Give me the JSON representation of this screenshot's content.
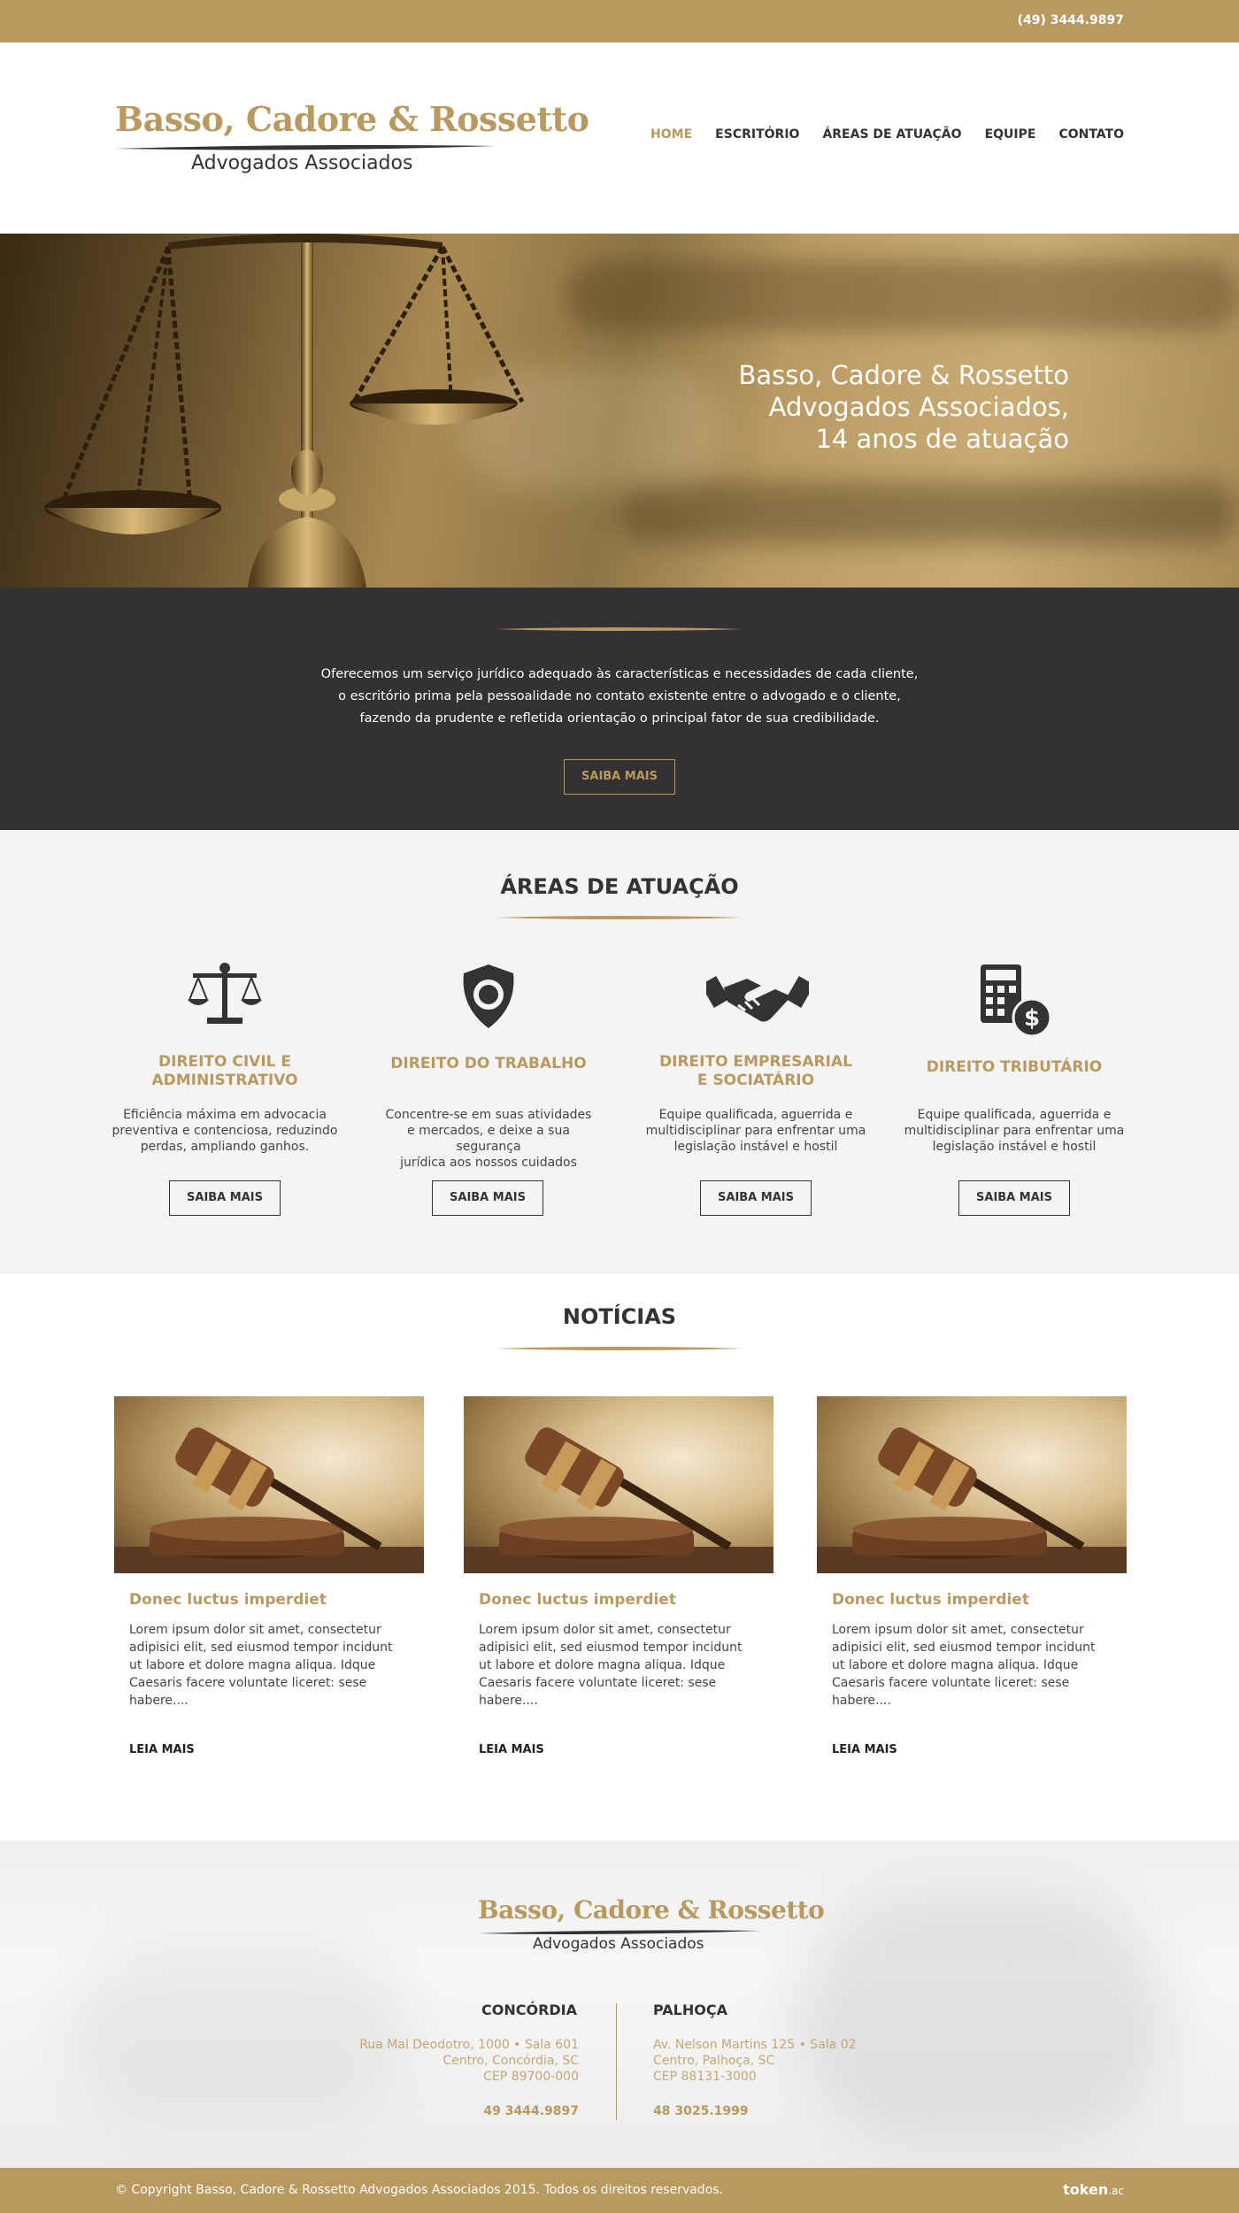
{
  "topbar": {
    "phone": "(49) 3444.9897"
  },
  "header": {
    "logo_line1": "Basso, Cadore & Rossetto",
    "logo_line2": "Advogados Associados",
    "nav": [
      "HOME",
      "ESCRITÓRIO",
      "ÁREAS DE ATUAÇÃO",
      "EQUIPE",
      "CONTATO"
    ]
  },
  "hero": {
    "line1": "Basso, Cadore & Rossetto",
    "line2": "Advogados Associados,",
    "line3": "14 anos de atuação"
  },
  "intro": {
    "line1": "Oferecemos um serviço jurídico adequado às características e necessidades de cada cliente,",
    "line2": "o escritório prima pela pessoalidade no contato existente entre o advogado e o cliente,",
    "line3": "fazendo da prudente e refletida orientação o principal fator de sua credibilidade.",
    "button": "SAIBA MAIS"
  },
  "areas": {
    "title": "ÁREAS DE ATUAÇÃO",
    "items": [
      {
        "title1": "DIREITO CIVIL E",
        "title2": "ADMINISTRATIVO",
        "text1": "Eficiência máxima em advocacia",
        "text2": "preventiva e contenciosa, reduzindo",
        "text3": "perdas, ampliando ganhos.",
        "button": "SAIBA MAIS",
        "icon": "scales-icon"
      },
      {
        "title1": "DIREITO DO TRABALHO",
        "title2": "",
        "text1": "Concentre-se em suas atividades",
        "text2": "e mercados, e deixe a sua segurança",
        "text3": "jurídica aos nossos cuidados",
        "button": "SAIBA MAIS",
        "icon": "badge-icon"
      },
      {
        "title1": "DIREITO EMPRESARIAL",
        "title2": "E SOCIATÁRIO",
        "text1": "Equipe qualificada, aguerrida e",
        "text2": "multidisciplinar para enfrentar uma",
        "text3": "legislação instável e hostil",
        "button": "SAIBA MAIS",
        "icon": "handshake-icon"
      },
      {
        "title1": "DIREITO TRIBUTÁRIO",
        "title2": "",
        "text1": "Equipe qualificada, aguerrida e",
        "text2": "multidisciplinar para enfrentar uma",
        "text3": "legislação instável e hostil",
        "button": "SAIBA MAIS",
        "icon": "calculator-dollar-icon"
      }
    ]
  },
  "news": {
    "title": "NOTÍCIAS",
    "items": [
      {
        "title": "Donec luctus imperdiet",
        "text": "Lorem ipsum dolor sit amet, consectetur adipisici elit, sed eiusmod tempor incidunt ut labore et dolore magna aliqua. Idque Caesaris facere voluntate liceret: sese habere....",
        "more": "LEIA MAIS"
      },
      {
        "title": "Donec luctus imperdiet",
        "text": "Lorem ipsum dolor sit amet, consectetur adipisici elit, sed eiusmod tempor incidunt ut labore et dolore magna aliqua. Idque Caesaris facere voluntate liceret: sese habere....",
        "more": "LEIA MAIS"
      },
      {
        "title": "Donec luctus imperdiet",
        "text": "Lorem ipsum dolor sit amet, consectetur adipisici elit, sed eiusmod tempor incidunt ut labore et dolore magna aliqua. Idque Caesaris facere voluntate liceret: sese habere....",
        "more": "LEIA MAIS"
      }
    ]
  },
  "footer": {
    "logo_line1": "Basso, Cadore & Rossetto",
    "logo_line2": "Advogados Associados",
    "offices": [
      {
        "name": "CONCÓRDIA",
        "addr1": "Rua Mal Deodotro, 1000 • Sala 601",
        "addr2": "Centro, Concórdia, SC",
        "addr3": "CEP 89700-000",
        "phone": "49 3444.9897"
      },
      {
        "name": "PALHOÇA",
        "addr1": "Av. Nelson Martins 125 • Sala 02",
        "addr2": "Centro, Palhoça, SC",
        "addr3": "CEP 88131-3000",
        "phone": "48 3025.1999"
      }
    ]
  },
  "bottombar": {
    "copyright": "© Copyright Basso, Cadore & Rossetto Advogados Associados 2015. Todos os direitos reservados.",
    "credit": "token",
    "credit_suffix": ".ac"
  },
  "colors": {
    "gold": "#b8995f",
    "dark": "#333132",
    "light": "#f4f4f4"
  }
}
